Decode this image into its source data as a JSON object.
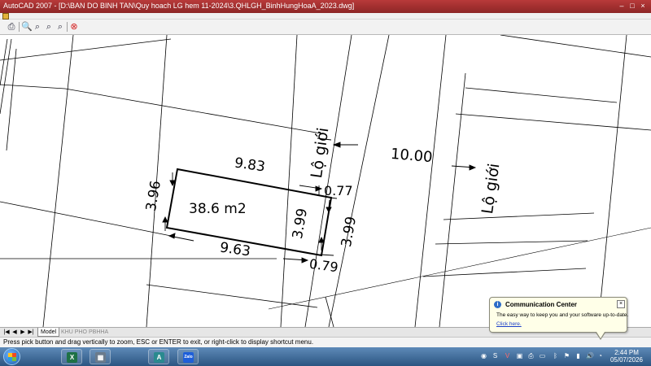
{
  "window": {
    "title": "AutoCAD 2007 - [D:\\BAN DO BINH TAN\\Quy hoach LG hem 11-2024\\3.QHLGH_BinhHungHoaA_2023.dwg]",
    "min_glyph": "–",
    "max_glyph": "□",
    "close_glyph": "×"
  },
  "toolbar": {
    "icons": [
      "print-icon",
      "zoom-realtime-icon",
      "zoom-window-icon",
      "zoom-previous-icon",
      "zoom-extents-icon",
      "close-preview-icon"
    ]
  },
  "drawing": {
    "lot_top_length": "9.83",
    "lot_bottom_length": "9.63",
    "lot_left_depth": "3.96",
    "lot_inner_depth": "3.99",
    "lot_outer_depth": "3.99",
    "corner_top_offset": "0.77",
    "corner_bottom_offset": "0.79",
    "area": "38.6 m2",
    "road_width": "10.00",
    "setback_label_left": "Lộ giới",
    "setback_label_right": "Lộ giới"
  },
  "tabs": [
    {
      "label": "Model",
      "active": true
    },
    {
      "label": "KHU PHO",
      "active": false
    },
    {
      "label": "PBHHA",
      "active": false
    }
  ],
  "command_line": {
    "prompt": "Press pick button and drag vertically to zoom, ESC or ENTER to exit, or right-click to display shortcut menu."
  },
  "notification": {
    "title": "Communication Center",
    "message": "The easy way to keep you and your software up-to-date.",
    "link": "Click here.",
    "close": "×"
  },
  "taskbar": {
    "apps": [
      {
        "name": "excel-icon",
        "glyph": "X",
        "color": "#1e7145"
      },
      {
        "name": "calculator-icon",
        "glyph": "▦",
        "color": "#6b7b8c"
      },
      {
        "name": "autocad-icon",
        "glyph": "A",
        "color": "#2a8a8f"
      },
      {
        "name": "zalo-icon",
        "glyph": "Zalo",
        "color": "#1e5fd9"
      }
    ],
    "clock_time": "2:44 PM",
    "clock_date": "05/07/2026"
  }
}
